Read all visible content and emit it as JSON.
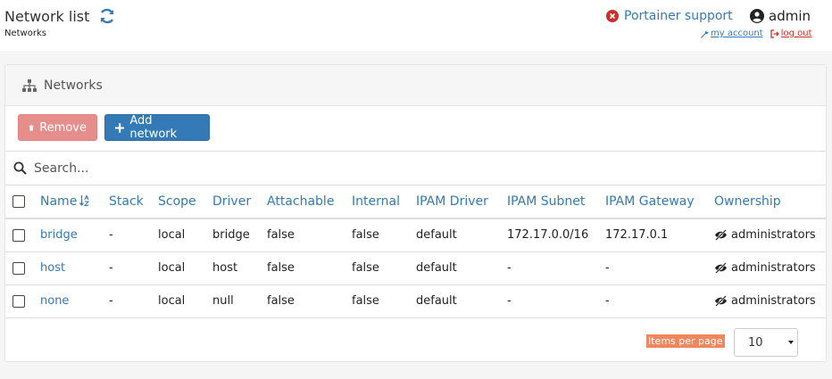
{
  "header": {
    "title": "Network list",
    "breadcrumb": "Networks",
    "support_label": "Portainer support",
    "username": "admin",
    "my_account_label": "my account",
    "logout_label": "log out"
  },
  "widget": {
    "title": "Networks",
    "remove_label": "Remove",
    "add_label": "Add network",
    "search_placeholder": "Search..."
  },
  "table": {
    "columns": [
      "Name",
      "Stack",
      "Scope",
      "Driver",
      "Attachable",
      "Internal",
      "IPAM Driver",
      "IPAM Subnet",
      "IPAM Gateway",
      "Ownership"
    ],
    "rows": [
      [
        "bridge",
        "-",
        "local",
        "bridge",
        "false",
        "false",
        "default",
        "172.17.0.0/16",
        "172.17.0.1",
        "administrators"
      ],
      [
        "host",
        "-",
        "local",
        "host",
        "false",
        "false",
        "default",
        "-",
        "-",
        "administrators"
      ],
      [
        "none",
        "-",
        "local",
        "null",
        "false",
        "false",
        "default",
        "-",
        "-",
        "administrators"
      ]
    ]
  },
  "pagination": {
    "items_per_page_label": "Items per page",
    "items_per_page_value": "10"
  },
  "colors": {
    "primary": "#337ab7",
    "danger_light": "#e58e8c",
    "danger": "#c9302c",
    "label_bg": "#f0865e"
  }
}
